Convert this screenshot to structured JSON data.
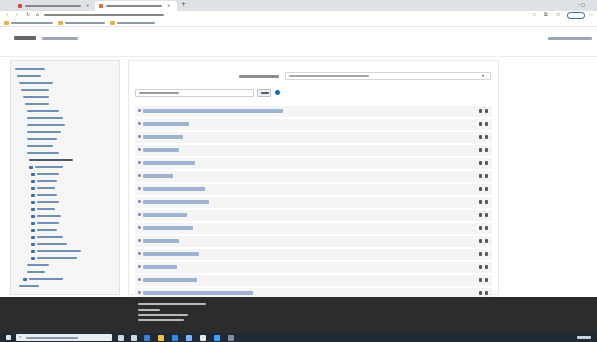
{
  "browser": {
    "tabs": [
      {
        "label": "",
        "active": false
      },
      {
        "label": "",
        "active": true
      }
    ],
    "address": "",
    "bookmarks": [
      "",
      "",
      ""
    ]
  },
  "site": {
    "brand": "",
    "user_menu": ""
  },
  "search": {
    "label": "",
    "placeholder": "",
    "button": "",
    "dropdown_value": ""
  },
  "sidebar": {
    "items": [
      "",
      "",
      "",
      "",
      "",
      "",
      "",
      "",
      "",
      "",
      "",
      "",
      "",
      "",
      "",
      "",
      "",
      "",
      "",
      "",
      "",
      "",
      "",
      "",
      "",
      "",
      "",
      "",
      "",
      "",
      "",
      ""
    ]
  },
  "courses": [
    "",
    "",
    "",
    "",
    "",
    "",
    "",
    "",
    "",
    "",
    "",
    "",
    "",
    "",
    ""
  ],
  "footer": [
    "",
    "",
    "",
    ""
  ],
  "taskbar": {
    "search_placeholder": "",
    "clock": ""
  },
  "colors": {
    "link": "#3a6fb0",
    "accent": "#0f6cbf",
    "footer_bg": "#2c2c2c",
    "taskbar_bg": "#1f2a37"
  }
}
